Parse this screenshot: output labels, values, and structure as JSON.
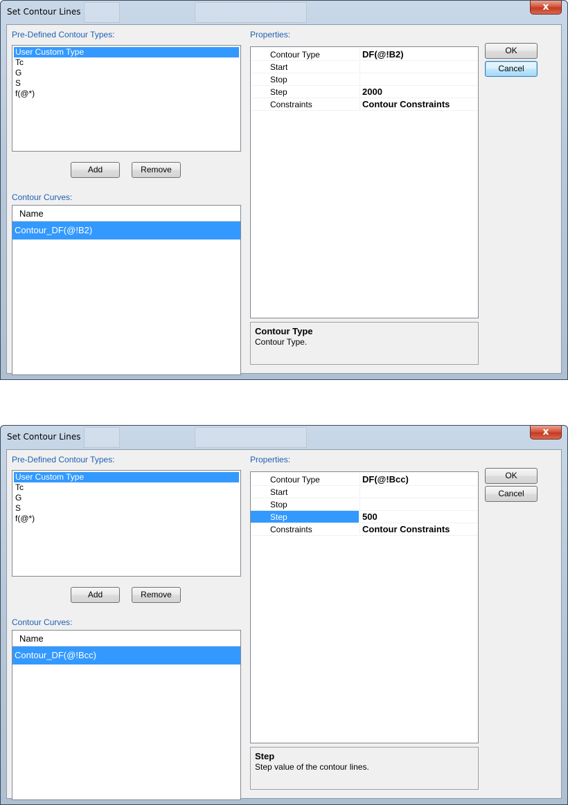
{
  "dialogs": [
    {
      "title": "Set Contour Lines",
      "predefined_label": "Pre-Defined Contour Types:",
      "predefined_types": [
        "User Custom Type",
        "Tc",
        "G",
        "S",
        "f(@*)"
      ],
      "selected_type": "User Custom Type",
      "add_label": "Add",
      "remove_label": "Remove",
      "curves_label": "Contour Curves:",
      "curves_header": "Name",
      "curves": [
        "Contour_DF(@!B2)"
      ],
      "properties_label": "Properties:",
      "properties": [
        {
          "name": "Contour Type",
          "value": "DF(@!B2)"
        },
        {
          "name": "Start",
          "value": ""
        },
        {
          "name": "Stop",
          "value": ""
        },
        {
          "name": "Step",
          "value": "2000"
        },
        {
          "name": "Constraints",
          "value": "Contour Constraints"
        }
      ],
      "selected_property": "",
      "description_title": "Contour Type",
      "description_text": "Contour Type.",
      "ok_label": "OK",
      "cancel_label": "Cancel",
      "default_button": "cancel",
      "close_glyph": "x"
    },
    {
      "title": "Set Contour Lines",
      "predefined_label": "Pre-Defined Contour Types:",
      "predefined_types": [
        "User Custom Type",
        "Tc",
        "G",
        "S",
        "f(@*)"
      ],
      "selected_type": "User Custom Type",
      "add_label": "Add",
      "remove_label": "Remove",
      "curves_label": "Contour Curves:",
      "curves_header": "Name",
      "curves": [
        "Contour_DF(@!Bcc)"
      ],
      "properties_label": "Properties:",
      "properties": [
        {
          "name": "Contour Type",
          "value": "DF(@!Bcc)"
        },
        {
          "name": "Start",
          "value": ""
        },
        {
          "name": "Stop",
          "value": ""
        },
        {
          "name": "Step",
          "value": "500"
        },
        {
          "name": "Constraints",
          "value": "Contour Constraints"
        }
      ],
      "selected_property": "Step",
      "description_title": "Step",
      "description_text": "Step value of the contour lines.",
      "ok_label": "OK",
      "cancel_label": "Cancel",
      "default_button": "",
      "close_glyph": "x"
    }
  ],
  "colors": {
    "selection": "#3399ff",
    "group_label": "#1f5fb4",
    "close_button": "#c23b22"
  }
}
